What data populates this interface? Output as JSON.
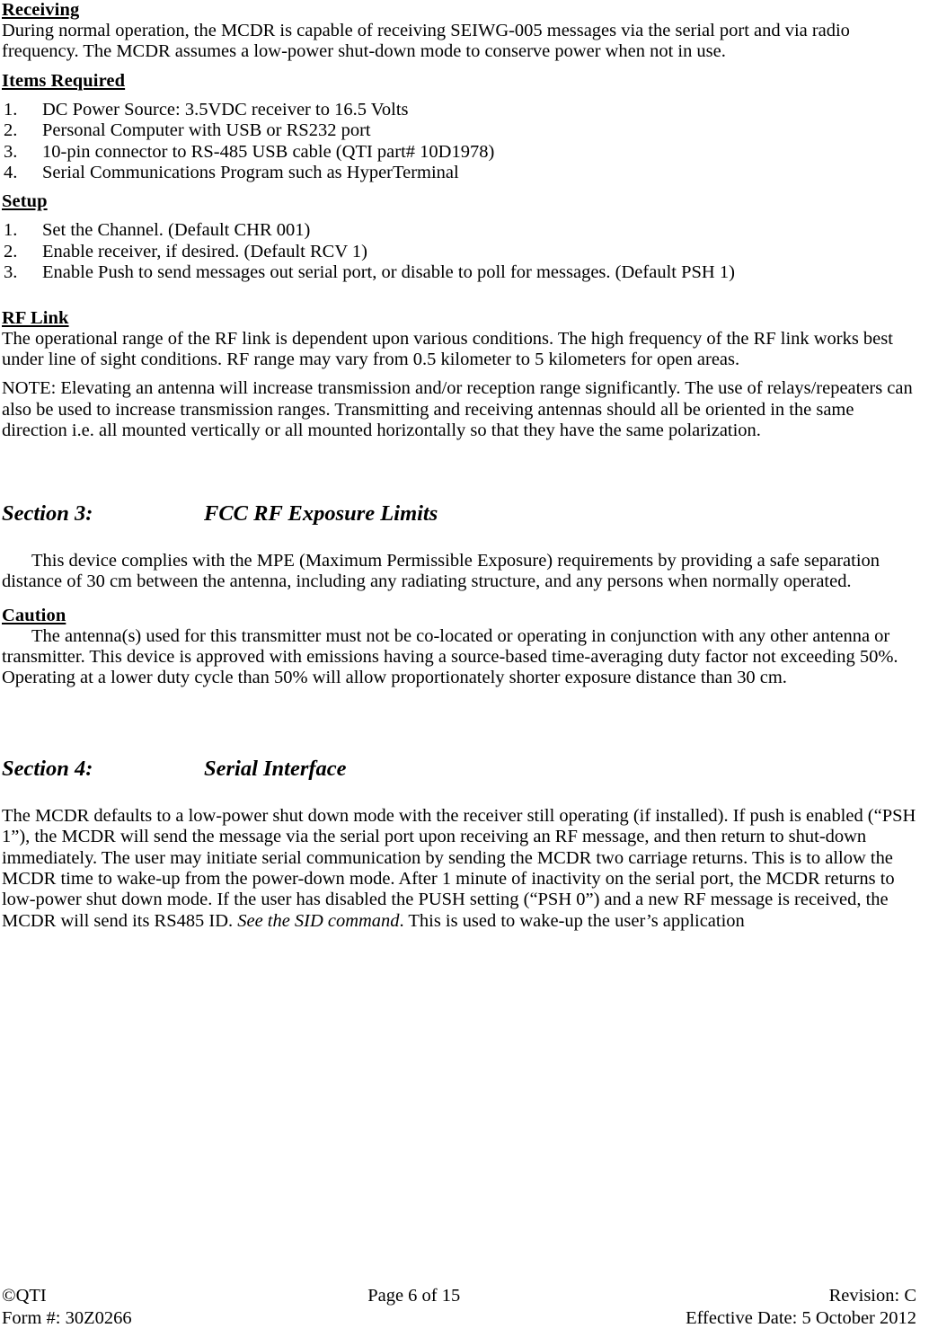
{
  "document": {
    "section_receiving": {
      "heading": "Receiving",
      "paragraph": "During normal operation, the MCDR is capable of receiving SEIWG-005 messages via the serial port and via radio frequency.  The MCDR assumes a low-power shut-down mode to conserve power when not in use."
    },
    "section_items_required": {
      "heading": "Items Required",
      "items": [
        {
          "marker": "1.",
          "text": "DC Power Source:  3.5VDC receiver to 16.5 Volts"
        },
        {
          "marker": "2.",
          "text": "Personal Computer with USB or RS232 port"
        },
        {
          "marker": "3.",
          "text": "10-pin connector to RS-485 USB cable (QTI part# 10D1978)"
        },
        {
          "marker": "4.",
          "text": "Serial Communications Program such as HyperTerminal"
        }
      ]
    },
    "section_setup": {
      "heading": "Setup",
      "items": [
        {
          "marker": "1.",
          "text": "Set the Channel.  (Default CHR 001)"
        },
        {
          "marker": "2.",
          "text": "Enable receiver, if desired.  (Default RCV 1)"
        },
        {
          "marker": "3.",
          "text": "Enable Push to send messages out serial port, or disable to poll for messages.  (Default PSH 1)"
        }
      ]
    },
    "section_rf_link": {
      "heading": "RF Link",
      "paragraph": "The operational range of the RF link is dependent upon various conditions.  The high frequency of the RF link works best under line of sight conditions.  RF range may vary from 0.5 kilometer to 5 kilometers for open areas.",
      "note": "NOTE:  Elevating an antenna will increase transmission and/or reception range significantly.  The use of relays/repeaters can also be used to increase transmission ranges.  Transmitting and receiving antennas should all be oriented in the same direction i.e. all mounted vertically or all mounted horizontally so that they have the same polarization."
    },
    "section_3": {
      "label": "Section 3:",
      "title": "FCC RF Exposure Limits",
      "paragraph": "This device complies with the MPE (Maximum Permissible Exposure) requirements by providing a safe separation distance of 30 cm between the antenna, including any radiating structure, and any persons when normally operated.",
      "caution_heading": "Caution",
      "caution_paragraph": "The antenna(s) used for this transmitter must not be co-located or operating in conjunction with any other antenna or transmitter.  This device is approved with emissions having a source-based time-averaging duty factor not exceeding 50%. Operating at a lower duty cycle than 50% will allow proportionately shorter exposure distance than 30 cm."
    },
    "section_4": {
      "label": "Section 4:",
      "title": "Serial Interface",
      "paragraph_part1": "The MCDR defaults to a low-power shut down mode with the receiver still operating (if installed).  If push is enabled (“PSH 1”), the MCDR will send the message via the serial port upon receiving an RF message, and then return to shut-down immediately.  The user may initiate serial communication by sending the MCDR two carriage returns. This is to allow the MCDR time to wake-up from the power-down mode.  After 1 minute of inactivity on the serial port, the MCDR returns to low-power shut down mode.  If the user has disabled the PUSH setting (“PSH 0”) and a new RF message is received, the MCDR will send its RS485 ID. ",
      "paragraph_italic": "See the SID command",
      "paragraph_part2": ". This is used to wake-up the user’s application"
    }
  },
  "footer": {
    "copyright": "©QTI",
    "page": "Page 6 of 15",
    "revision": "Revision: C",
    "form": "Form #: 30Z0266",
    "effective_date": "Effective Date: 5 October 2012"
  }
}
